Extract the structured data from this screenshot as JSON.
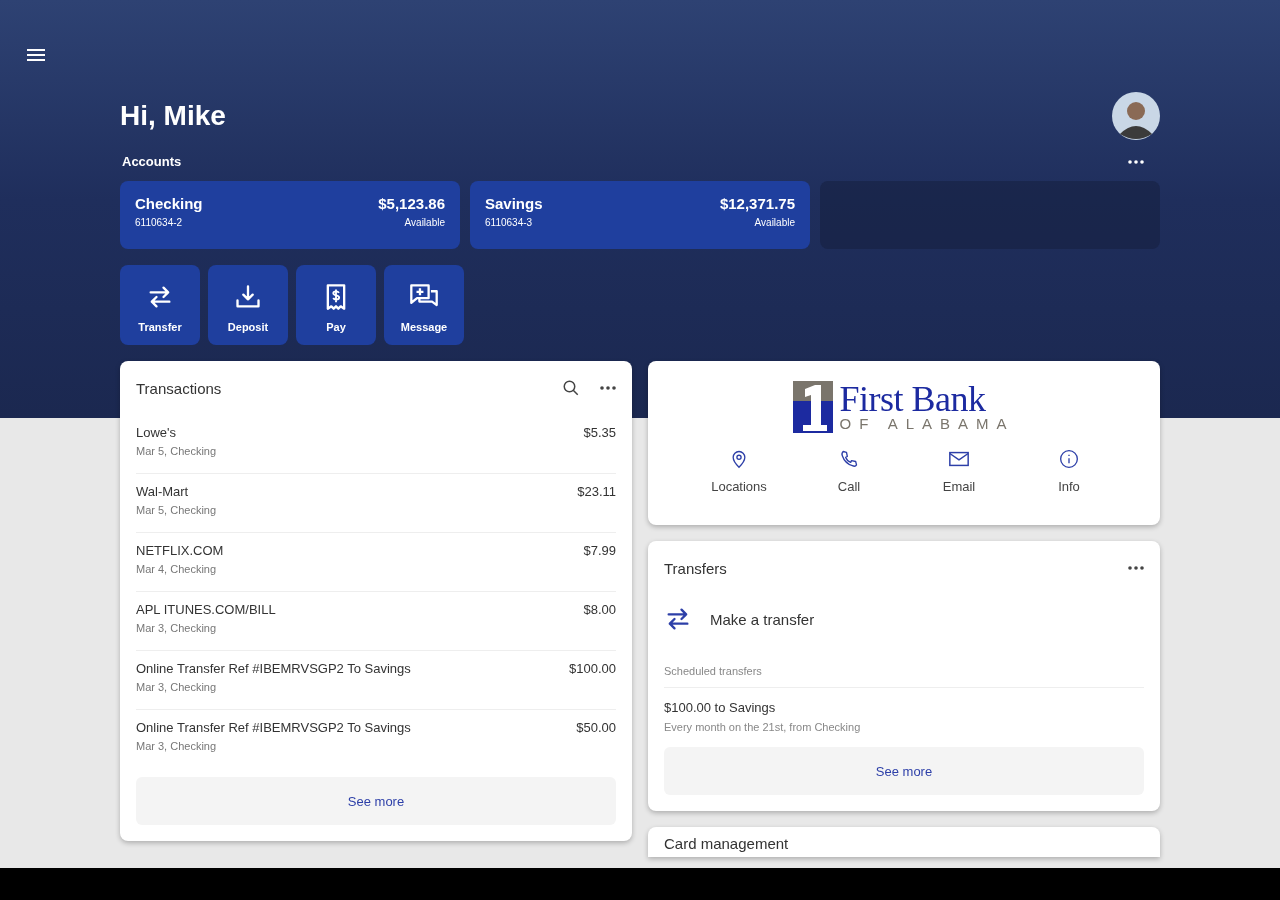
{
  "greeting": "Hi, Mike",
  "accounts_label": "Accounts",
  "accounts": [
    {
      "name": "Checking",
      "number": "6110634-2",
      "balance": "$5,123.86",
      "balance_label": "Available"
    },
    {
      "name": "Savings",
      "number": "6110634-3",
      "balance": "$12,371.75",
      "balance_label": "Available"
    }
  ],
  "quick_actions": [
    {
      "kind": "transfer",
      "label": "Transfer"
    },
    {
      "kind": "deposit",
      "label": "Deposit"
    },
    {
      "kind": "pay",
      "label": "Pay"
    },
    {
      "kind": "message",
      "label": "Message"
    }
  ],
  "transactions": {
    "title": "Transactions",
    "items": [
      {
        "name": "Lowe's",
        "detail": "Mar 5, Checking",
        "amount": "$5.35"
      },
      {
        "name": "Wal-Mart",
        "detail": "Mar 5, Checking",
        "amount": "$23.11"
      },
      {
        "name": "NETFLIX.COM",
        "detail": "Mar 4, Checking",
        "amount": "$7.99"
      },
      {
        "name": "APL ITUNES.COM/BILL",
        "detail": "Mar 3, Checking",
        "amount": "$8.00"
      },
      {
        "name": "Online Transfer Ref #IBEMRVSGP2 To Savings",
        "detail": "Mar 3, Checking",
        "amount": "$100.00"
      },
      {
        "name": "Online Transfer Ref #IBEMRVSGP2 To Savings",
        "detail": "Mar 3, Checking",
        "amount": "$50.00"
      }
    ],
    "see_more": "See more"
  },
  "bank": {
    "name": "First Bank",
    "subtitle": "OF ALABAMA",
    "actions": [
      {
        "kind": "location",
        "label": "Locations"
      },
      {
        "kind": "call",
        "label": "Call"
      },
      {
        "kind": "email",
        "label": "Email"
      },
      {
        "kind": "info",
        "label": "Info"
      }
    ]
  },
  "transfers": {
    "title": "Transfers",
    "make_transfer": "Make a transfer",
    "scheduled_label": "Scheduled transfers",
    "scheduled": [
      {
        "title": "$100.00 to Savings",
        "detail": "Every month on the 21st, from Checking"
      }
    ],
    "see_more": "See more"
  },
  "card_management": {
    "title": "Card management"
  }
}
